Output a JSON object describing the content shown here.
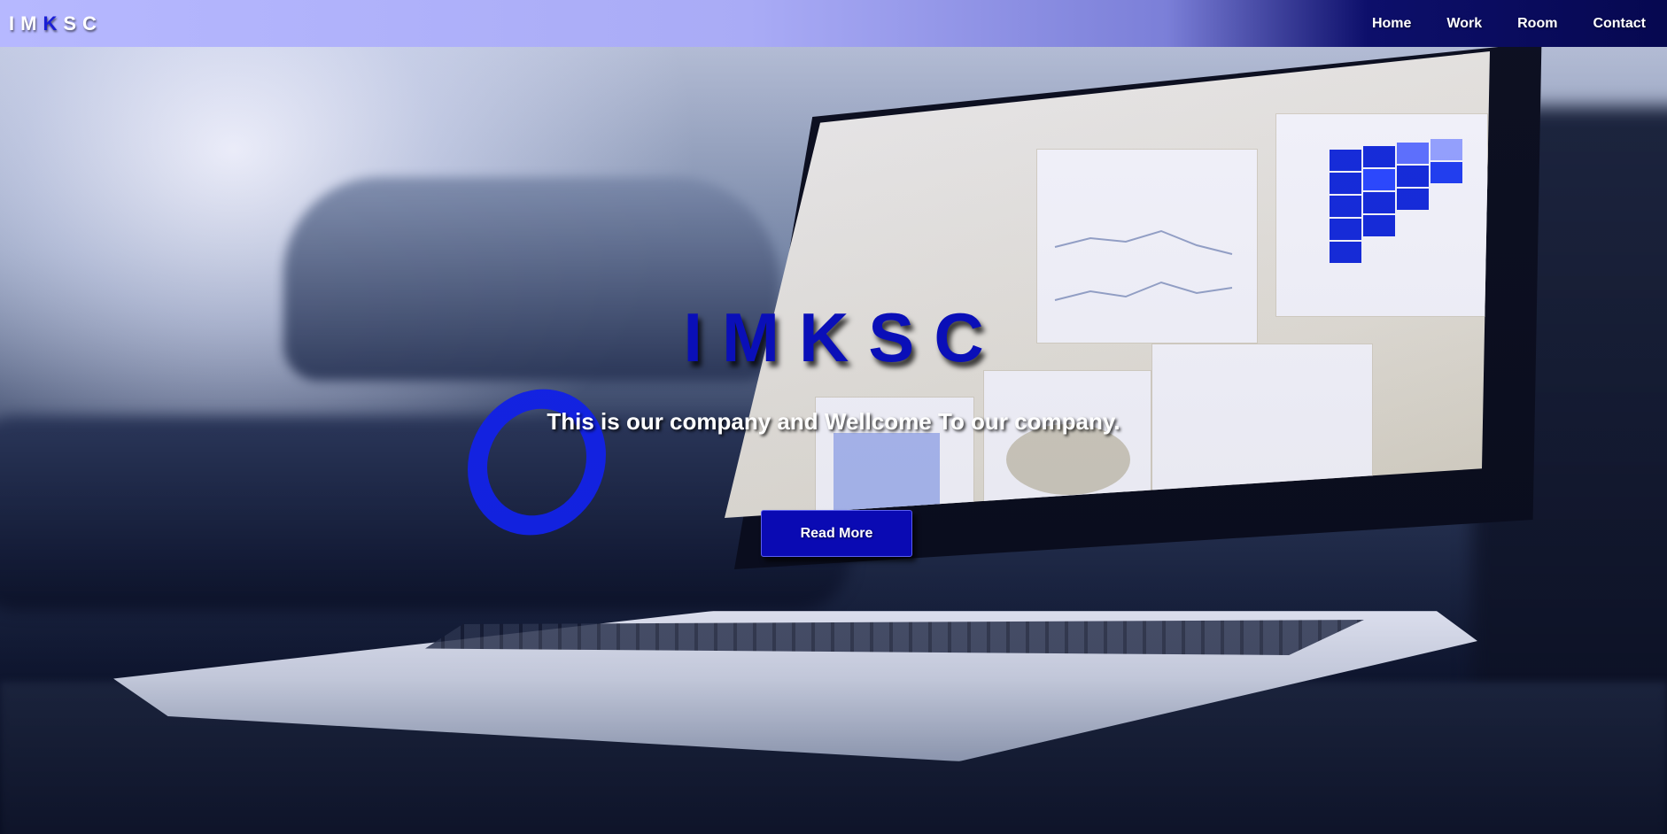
{
  "nav": {
    "brand_parts": [
      "IM",
      "K",
      "SC"
    ],
    "links": [
      "Home",
      "Work",
      "Room",
      "Contact"
    ]
  },
  "hero": {
    "title": "IMKSC",
    "subtitle": "This is our company and Wellcome To our company.",
    "button_label": "Read More"
  },
  "colors": {
    "accent": "#0a0ab3",
    "title": "#0a0fb8",
    "nav_start": "#b6b8ff",
    "nav_end": "#060850"
  }
}
